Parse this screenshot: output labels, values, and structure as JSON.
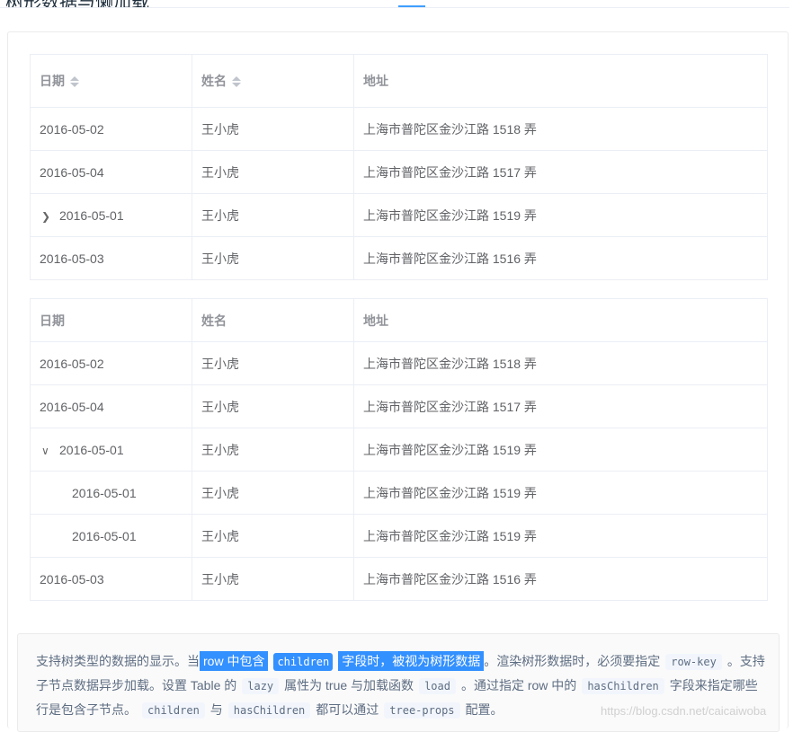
{
  "header": {
    "title": "树形数据与懒加载"
  },
  "table_sortable": {
    "columns": [
      "日期",
      "姓名",
      "地址"
    ],
    "rows": [
      {
        "date": "2016-05-02",
        "name": "王小虎",
        "address": "上海市普陀区金沙江路 1518 弄"
      },
      {
        "date": "2016-05-04",
        "name": "王小虎",
        "address": "上海市普陀区金沙江路 1517 弄"
      },
      {
        "date": "2016-05-01",
        "name": "王小虎",
        "address": "上海市普陀区金沙江路 1519 弄",
        "expand_icon": "chevron-right"
      },
      {
        "date": "2016-05-03",
        "name": "王小虎",
        "address": "上海市普陀区金沙江路 1516 弄"
      }
    ]
  },
  "table_lazy": {
    "columns": [
      "日期",
      "姓名",
      "地址"
    ],
    "rows": [
      {
        "date": "2016-05-02",
        "name": "王小虎",
        "address": "上海市普陀区金沙江路 1518 弄"
      },
      {
        "date": "2016-05-04",
        "name": "王小虎",
        "address": "上海市普陀区金沙江路 1517 弄"
      },
      {
        "date": "2016-05-01",
        "name": "王小虎",
        "address": "上海市普陀区金沙江路 1519 弄",
        "expand_icon": "chevron-down"
      },
      {
        "date": "2016-05-01",
        "name": "王小虎",
        "address": "上海市普陀区金沙江路 1519 弄"
      },
      {
        "date": "2016-05-01",
        "name": "王小虎",
        "address": "上海市普陀区金沙江路 1519 弄"
      },
      {
        "date": "2016-05-03",
        "name": "王小虎",
        "address": "上海市普陀区金沙江路 1516 弄"
      }
    ]
  },
  "description": {
    "t1": "支持树类型的数据的显示。当",
    "hl1": "row 中包含",
    "code_children": "children",
    "hl2": "字段时，被视为树形数据",
    "t2": "。渲染树形数据时，必须要指定",
    "code_rowkey": "row-key",
    "t3": "。支持子节点数据异步加载。设置 Table 的",
    "code_lazy": "lazy",
    "t4": "属性为 true 与加载函数",
    "code_load": "load",
    "t5": "。通过指定 row 中的",
    "code_haschildren": "hasChildren",
    "t6": "字段来指定哪些行是包含子节点。",
    "code_children2": "children",
    "t7": "与",
    "code_haschildren2": "hasChildren",
    "t8": "都可以通过",
    "code_treeprops": "tree-props",
    "t9": "配置。"
  },
  "watermark": "https://blog.csdn.net/caicaiwoba",
  "colors": {
    "accent": "#409eff",
    "selection": "#3390ff",
    "border": "#ebeef5",
    "text": "#606266",
    "header_text": "#909399"
  }
}
